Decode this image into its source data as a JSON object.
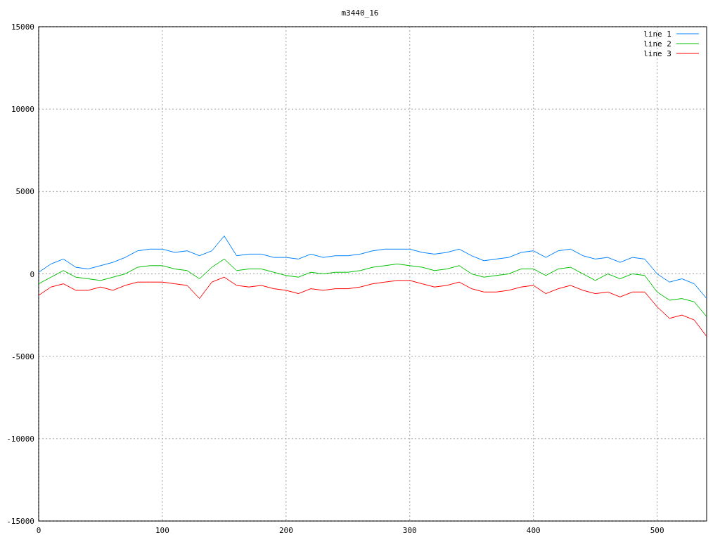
{
  "chart_data": {
    "type": "line",
    "title": "m3440_16",
    "x": [
      0,
      10,
      20,
      30,
      40,
      50,
      60,
      70,
      80,
      90,
      100,
      110,
      120,
      130,
      140,
      150,
      160,
      170,
      180,
      190,
      200,
      210,
      220,
      230,
      240,
      250,
      260,
      270,
      280,
      290,
      300,
      310,
      320,
      330,
      340,
      350,
      360,
      370,
      380,
      390,
      400,
      410,
      420,
      430,
      440,
      450,
      460,
      470,
      480,
      490,
      500,
      510,
      520,
      530,
      540
    ],
    "series": [
      {
        "name": "line 1",
        "color": "#0080ff",
        "values": [
          100,
          600,
          900,
          400,
          300,
          500,
          700,
          1000,
          1400,
          1500,
          1500,
          1300,
          1400,
          1100,
          1400,
          2300,
          1100,
          1200,
          1200,
          1000,
          1000,
          900,
          1200,
          1000,
          1100,
          1100,
          1200,
          1400,
          1500,
          1500,
          1500,
          1300,
          1200,
          1300,
          1500,
          1100,
          800,
          900,
          1000,
          1300,
          1400,
          1000,
          1400,
          1500,
          1100,
          900,
          1000,
          700,
          1000,
          900,
          0,
          -500,
          -300,
          -600,
          -1500
        ]
      },
      {
        "name": "line 2",
        "color": "#00c000",
        "values": [
          -600,
          -200,
          200,
          -200,
          -300,
          -400,
          -200,
          0,
          400,
          500,
          500,
          300,
          200,
          -300,
          400,
          900,
          200,
          300,
          300,
          100,
          -100,
          -200,
          100,
          0,
          100,
          100,
          200,
          400,
          500,
          600,
          500,
          400,
          200,
          300,
          500,
          0,
          -200,
          -100,
          0,
          300,
          300,
          -100,
          300,
          400,
          0,
          -400,
          0,
          -300,
          0,
          -100,
          -1100,
          -1600,
          -1500,
          -1700,
          -2600
        ]
      },
      {
        "name": "line 3",
        "color": "#ff0000",
        "values": [
          -1300,
          -800,
          -600,
          -1000,
          -1000,
          -800,
          -1000,
          -700,
          -500,
          -500,
          -500,
          -600,
          -700,
          -1500,
          -500,
          -200,
          -700,
          -800,
          -700,
          -900,
          -1000,
          -1200,
          -900,
          -1000,
          -900,
          -900,
          -800,
          -600,
          -500,
          -400,
          -400,
          -600,
          -800,
          -700,
          -500,
          -900,
          -1100,
          -1100,
          -1000,
          -800,
          -700,
          -1200,
          -900,
          -700,
          -1000,
          -1200,
          -1100,
          -1400,
          -1100,
          -1100,
          -2000,
          -2700,
          -2500,
          -2800,
          -3800
        ]
      }
    ],
    "xlim": [
      0,
      540
    ],
    "ylim": [
      -15000,
      15000
    ],
    "xticks": [
      0,
      100,
      200,
      300,
      400,
      500
    ],
    "yticks": [
      -15000,
      -10000,
      -5000,
      0,
      5000,
      10000,
      15000
    ],
    "grid": true,
    "legend": true
  }
}
